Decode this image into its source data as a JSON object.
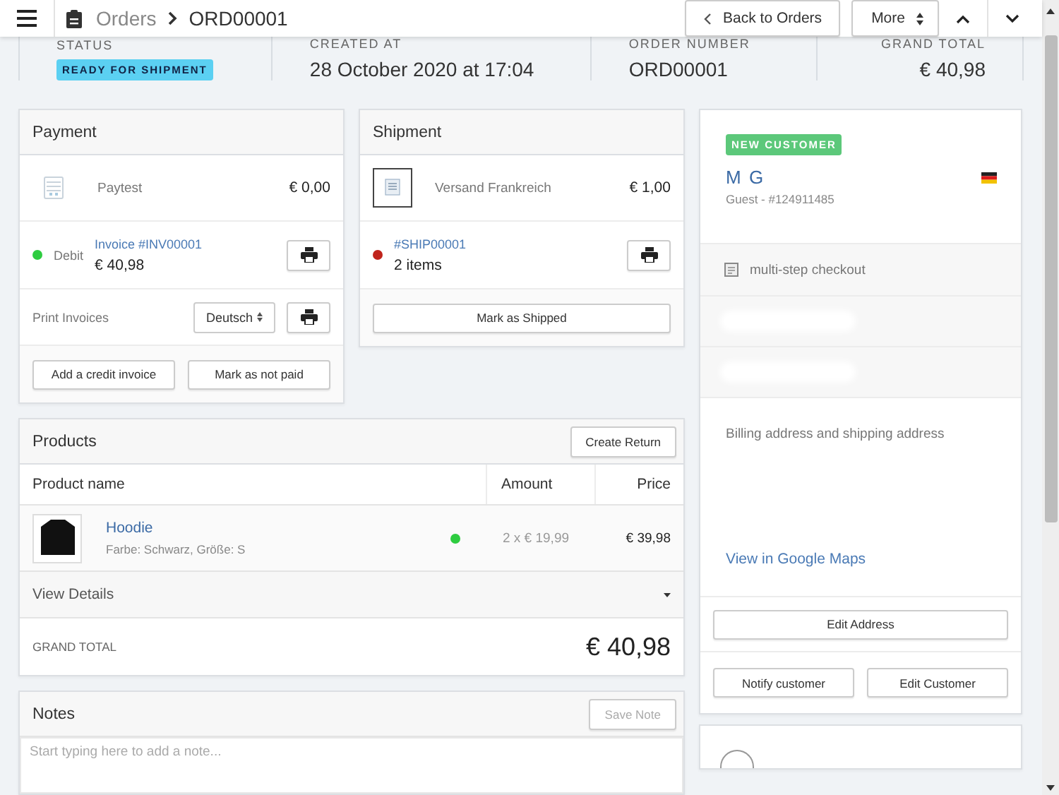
{
  "topbar": {
    "breadcrumb_parent": "Orders",
    "breadcrumb_current": "ORD00001",
    "back_button": "Back to Orders",
    "more_button": "More"
  },
  "summary": [
    {
      "label": "STATUS",
      "kind": "badge",
      "value": "READY FOR SHIPMENT"
    },
    {
      "label": "CREATED AT",
      "kind": "text",
      "value": "28 October 2020 at 17:04"
    },
    {
      "label": "ORDER NUMBER",
      "kind": "text",
      "value": "ORD00001"
    },
    {
      "label": "GRAND TOTAL",
      "kind": "text",
      "value": "€ 40,98"
    }
  ],
  "payment": {
    "title": "Payment",
    "method": "Paytest",
    "method_amount": "€ 0,00",
    "status": "Debit",
    "color": "#2ecc40",
    "invoice_link": "Invoice #INV00001",
    "invoice_amount": "€ 40,98",
    "print_label": "Print Invoices",
    "language": "Deutsch",
    "buttons": [
      "Add a credit invoice",
      "Mark as not paid"
    ]
  },
  "shipment": {
    "title": "Shipment",
    "method": "Versand Frankreich",
    "amount": "€ 1,00",
    "color": "#c0241c",
    "link": "#SHIP00001",
    "items": "2 items",
    "button": "Mark as Shipped"
  },
  "products": {
    "title": "Products",
    "create_return": "Create Return",
    "columns": [
      "Product name",
      "Amount",
      "Price"
    ],
    "rows": [
      {
        "name": "Hoodie",
        "variant": "Farbe: Schwarz, Größe: S",
        "color": "#2ecc40",
        "amount": "2 x € 19,99",
        "price": "€ 39,98"
      }
    ],
    "view_details": "View Details",
    "total_label": "GRAND TOTAL",
    "total": "€ 40,98"
  },
  "notes": {
    "title": "Notes",
    "save": "Save Note",
    "placeholder": "Start typing here to add a note..."
  },
  "customer": {
    "badge": "NEW CUSTOMER",
    "name": "M G",
    "guest": "Guest - #124911485",
    "checkout": "multi-step checkout",
    "address_label": "Billing address and shipping address",
    "maps_link": "View in Google Maps",
    "edit_address": "Edit Address",
    "buttons": [
      "Notify customer",
      "Edit Customer"
    ]
  }
}
